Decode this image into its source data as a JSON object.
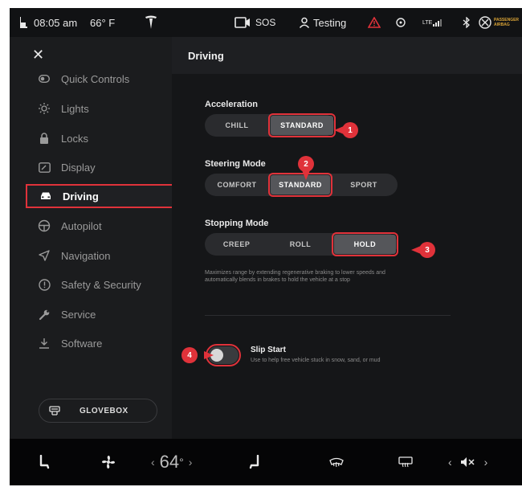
{
  "status_bar": {
    "time": "08:05 am",
    "temperature": "66° F",
    "sos": "SOS",
    "profile_name": "Testing",
    "lte": "LTE",
    "airbag_line1": "PASSENGER",
    "airbag_line2": "AIRBAG"
  },
  "sidebar": {
    "close": "✕",
    "items": [
      {
        "label": "Quick Controls",
        "icon": "toggle-icon"
      },
      {
        "label": "Lights",
        "icon": "sun-icon"
      },
      {
        "label": "Locks",
        "icon": "lock-icon"
      },
      {
        "label": "Display",
        "icon": "display-icon"
      },
      {
        "label": "Driving",
        "icon": "car-icon",
        "active": true
      },
      {
        "label": "Autopilot",
        "icon": "steering-wheel-icon"
      },
      {
        "label": "Navigation",
        "icon": "navigation-arrow-icon"
      },
      {
        "label": "Safety & Security",
        "icon": "alert-circle-icon"
      },
      {
        "label": "Service",
        "icon": "wrench-icon"
      },
      {
        "label": "Software",
        "icon": "download-icon"
      }
    ],
    "glovebox_label": "GLOVEBOX"
  },
  "main": {
    "title": "Driving",
    "acceleration": {
      "label": "Acceleration",
      "options": [
        "CHILL",
        "STANDARD"
      ],
      "selected": "STANDARD"
    },
    "steering": {
      "label": "Steering Mode",
      "options": [
        "COMFORT",
        "STANDARD",
        "SPORT"
      ],
      "selected": "STANDARD"
    },
    "stopping": {
      "label": "Stopping Mode",
      "options": [
        "CREEP",
        "ROLL",
        "HOLD"
      ],
      "selected": "HOLD",
      "description": "Maximizes range by extending regenerative braking to lower speeds and automatically blends in brakes to hold the vehicle at a stop"
    },
    "slip_start": {
      "title": "Slip Start",
      "description": "Use to help free vehicle stuck in snow, sand, or mud",
      "enabled": false
    }
  },
  "callouts": [
    "1",
    "2",
    "3",
    "4"
  ],
  "bottom_bar": {
    "cabin_temp": "64",
    "degree": "°",
    "left_arrow": "‹",
    "right_arrow": "›",
    "volume_left": "‹",
    "volume_right": "›",
    "volume_icon": "muted-speaker-icon"
  },
  "colors": {
    "accent_red": "#e0323a",
    "background": "#0d0e10",
    "sidebar": "#1b1c1e"
  }
}
